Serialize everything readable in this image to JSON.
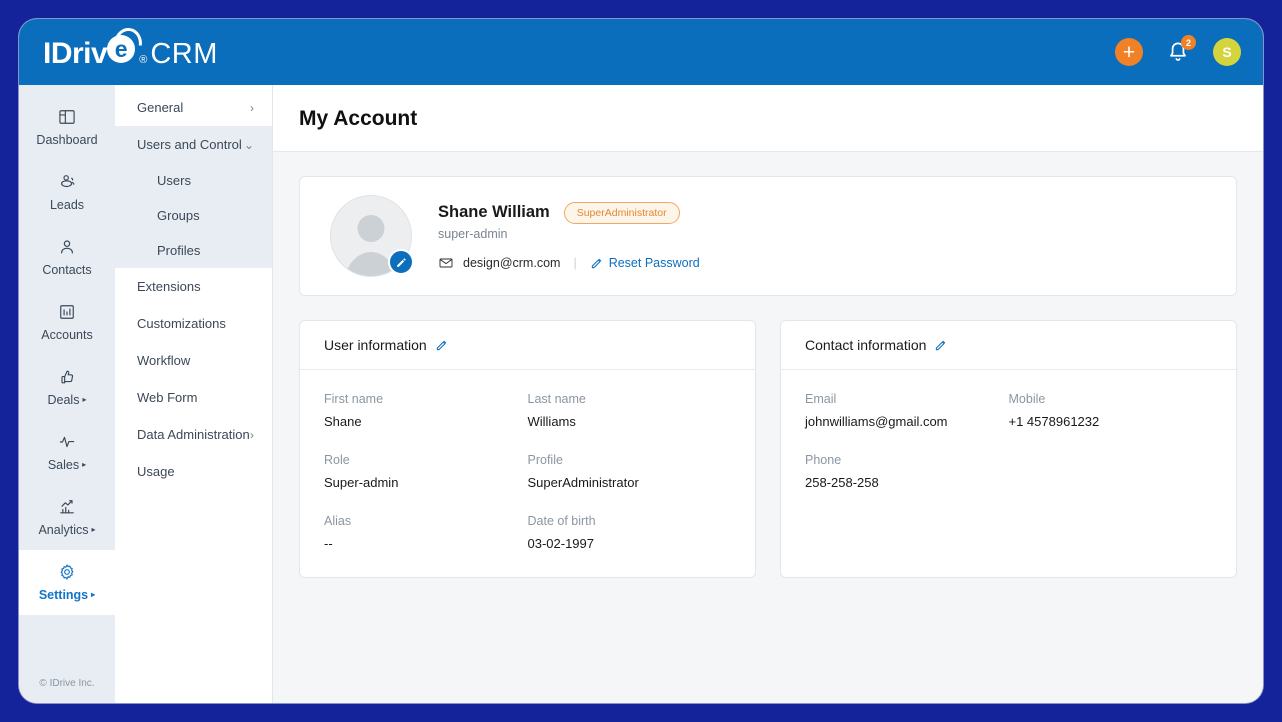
{
  "brand": {
    "name_part1": "IDriv",
    "name_e": "e",
    "registered": "®",
    "name_part2": "CRM",
    "header_color": "#0a6ebd",
    "accent_orange": "#f08127",
    "link_blue": "#0d6ebe"
  },
  "header": {
    "add_label": "+",
    "notification_count": "2",
    "avatar_initial": "S"
  },
  "rail": {
    "items": [
      {
        "label": "Dashboard",
        "icon": "dashboard-icon",
        "caret": "",
        "active": false
      },
      {
        "label": "Leads",
        "icon": "leads-icon",
        "caret": "",
        "active": false
      },
      {
        "label": "Contacts",
        "icon": "contacts-icon",
        "caret": "",
        "active": false
      },
      {
        "label": "Accounts",
        "icon": "accounts-icon",
        "caret": "",
        "active": false
      },
      {
        "label": "Deals",
        "icon": "thumbs-up-icon",
        "caret": "▸",
        "active": false
      },
      {
        "label": "Sales",
        "icon": "pulse-icon",
        "caret": "▸",
        "active": false
      },
      {
        "label": "Analytics",
        "icon": "bar-chart-icon",
        "caret": "▸",
        "active": false
      },
      {
        "label": "Settings",
        "icon": "gear-icon",
        "caret": "▸",
        "active": true
      }
    ],
    "footer": "© IDrive Inc."
  },
  "submenu": {
    "general": {
      "label": "General",
      "arrow": "›"
    },
    "users_and_control": {
      "label": "Users and Control",
      "arrow": "⌄"
    },
    "sub_items": [
      {
        "label": "Users"
      },
      {
        "label": "Groups"
      },
      {
        "label": "Profiles"
      }
    ],
    "items": [
      {
        "label": "Extensions",
        "arrow": ""
      },
      {
        "label": "Customizations",
        "arrow": ""
      },
      {
        "label": "Workflow",
        "arrow": ""
      },
      {
        "label": "Web Form",
        "arrow": ""
      },
      {
        "label": "Data Administration",
        "arrow": "›"
      },
      {
        "label": "Usage",
        "arrow": ""
      }
    ]
  },
  "page": {
    "title": "My Account"
  },
  "profile": {
    "name": "Shane William",
    "role_badge": "SuperAdministrator",
    "subtitle": "super-admin",
    "email": "design@crm.com",
    "reset_password": "Reset Password"
  },
  "user_information": {
    "title": "User information",
    "fields": [
      {
        "label": "First name",
        "value": "Shane"
      },
      {
        "label": "Last name",
        "value": "Williams"
      },
      {
        "label": "Role",
        "value": "Super-admin"
      },
      {
        "label": "Profile",
        "value": "SuperAdministrator"
      },
      {
        "label": "Alias",
        "value": "--"
      },
      {
        "label": "Date of birth",
        "value": "03-02-1997"
      }
    ]
  },
  "contact_information": {
    "title": "Contact information",
    "fields": [
      {
        "label": "Email",
        "value": "johnwilliams@gmail.com"
      },
      {
        "label": "Mobile",
        "value": "+1 4578961232"
      },
      {
        "label": "Phone",
        "value": "258-258-258"
      }
    ]
  }
}
